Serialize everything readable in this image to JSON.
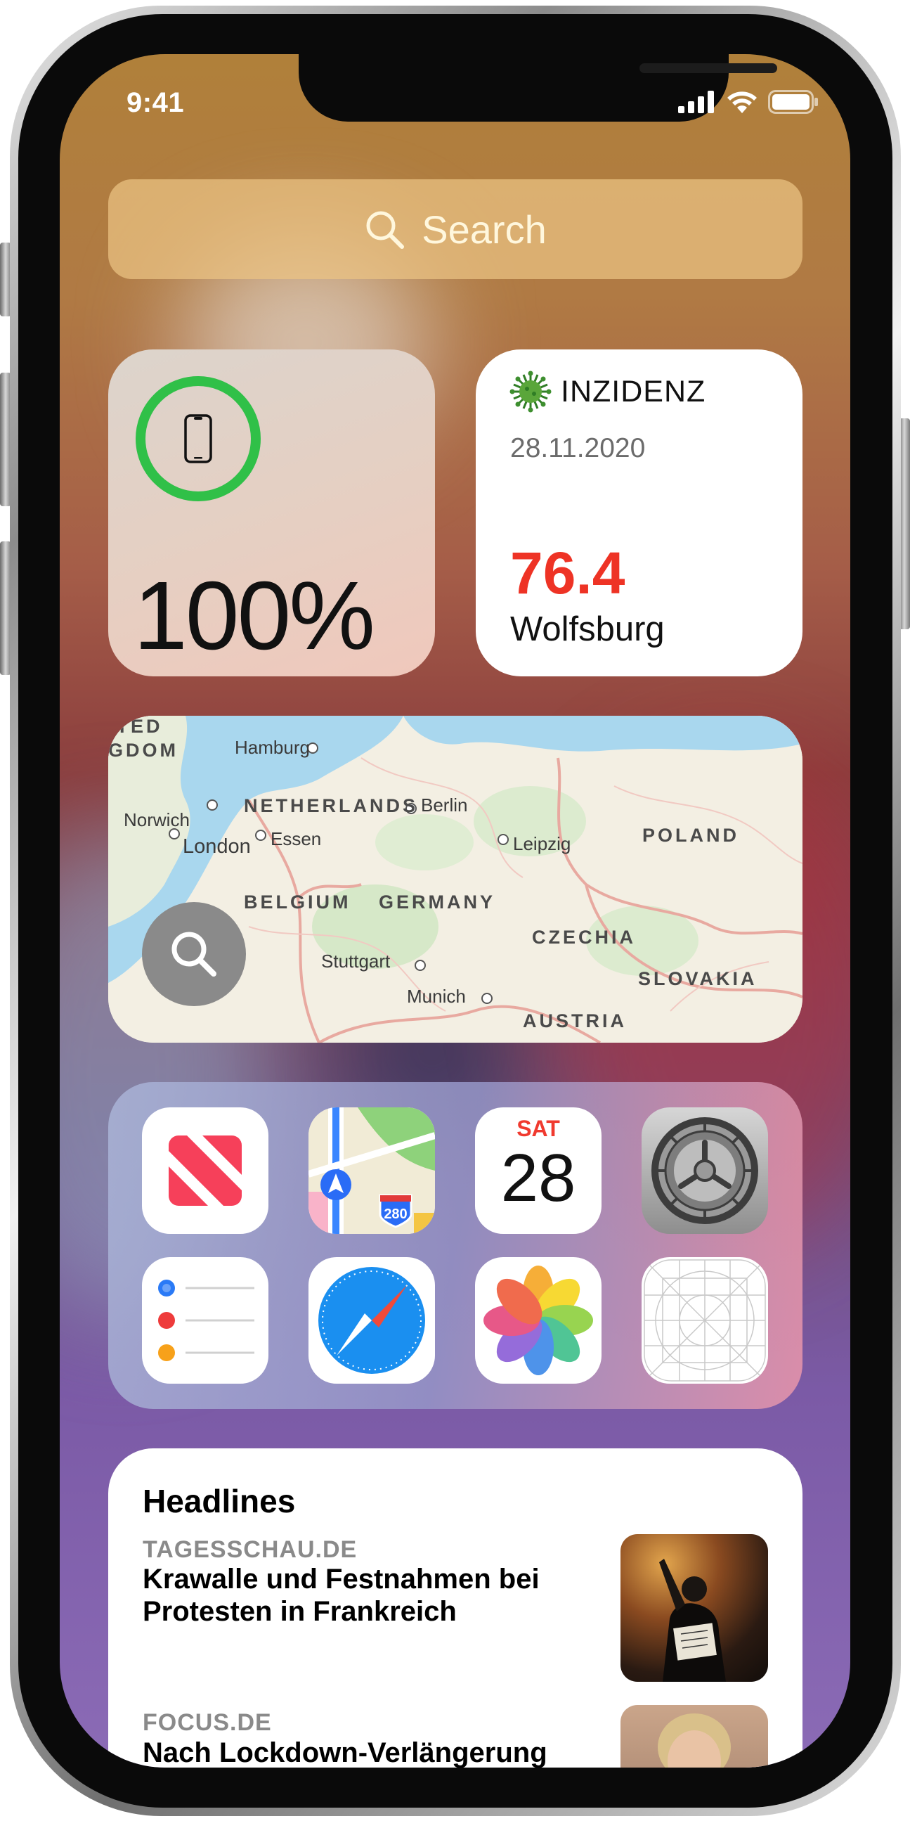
{
  "status_bar": {
    "time": "9:41"
  },
  "search": {
    "label": "Search"
  },
  "battery_widget": {
    "percent_label": "100%",
    "charge_fraction": 1.0,
    "ring_color": "#30c048"
  },
  "inzidenz_widget": {
    "title": "INZIDENZ",
    "date": "28.11.2020",
    "value": "76.4",
    "city": "Wolfsburg",
    "value_color": "#ee3325"
  },
  "map_widget": {
    "cities": [
      "Hamburg",
      "Norwich",
      "London",
      "Berlin",
      "Essen",
      "Leipzig",
      "Stuttgart",
      "Munich"
    ],
    "countries": [
      "ITED",
      "GDOM",
      "NETHERLANDS",
      "POLAND",
      "BELGIUM",
      "GERMANY",
      "CZECHIA",
      "SLOVAKIA",
      "AUSTRIA"
    ]
  },
  "apps_widget": {
    "apps": [
      {
        "name": "News",
        "icon": "news-icon"
      },
      {
        "name": "Maps",
        "icon": "maps-icon",
        "shield": "280"
      },
      {
        "name": "Calendar",
        "icon": "calendar-icon",
        "weekday": "SAT",
        "day": "28"
      },
      {
        "name": "Settings",
        "icon": "settings-gear-icon"
      },
      {
        "name": "Reminders",
        "icon": "reminders-icon"
      },
      {
        "name": "Safari",
        "icon": "safari-compass-icon"
      },
      {
        "name": "Photos",
        "icon": "photos-flower-icon"
      },
      {
        "name": "Placeholder",
        "icon": "app-template-grid-icon"
      }
    ]
  },
  "headlines_widget": {
    "title": "Headlines",
    "items": [
      {
        "source": "TAGESSCHAU.DE",
        "headline": "Krawalle und Festnahmen bei Protesten in Frankreich"
      },
      {
        "source": "FOCUS.DE",
        "headline": "Nach Lockdown-Verlängerung"
      }
    ]
  }
}
